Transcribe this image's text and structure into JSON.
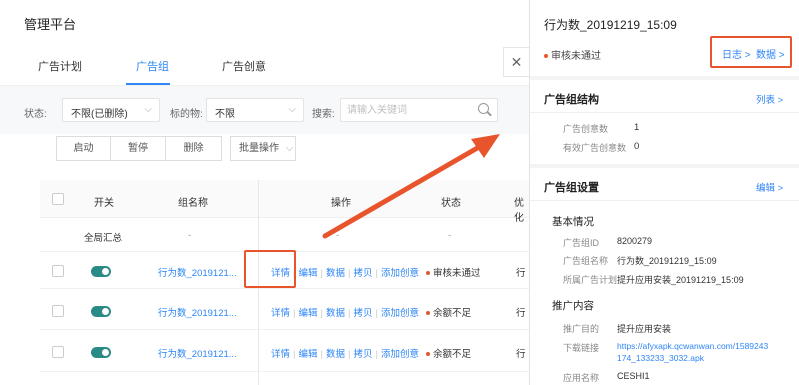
{
  "app": {
    "title": "管理平台"
  },
  "tabs": [
    {
      "label": "广告计划",
      "active": false
    },
    {
      "label": "广告组",
      "active": true
    },
    {
      "label": "广告创意",
      "active": false
    }
  ],
  "filters": {
    "status_label": "状态:",
    "status_value": "不限(已删除)",
    "target_label": "标的物:",
    "target_value": "不限",
    "search_label": "搜索:",
    "search_placeholder": "请输入关键词"
  },
  "actions": {
    "start": "启动",
    "pause": "暂停",
    "delete": "删除",
    "batch": "批量操作"
  },
  "table": {
    "headers": {
      "switch": "开关",
      "name": "组名称",
      "ops": "操作",
      "status": "状态",
      "budget": "优化"
    },
    "summary": {
      "label": "全局汇总",
      "name": "-",
      "ops": "-",
      "status": "-"
    },
    "rows": [
      {
        "name": "行为数_2019121...",
        "ops": [
          "详情",
          "编辑",
          "数据",
          "拷贝",
          "添加创意"
        ],
        "status": "审核未通过",
        "status_color": "#e8552c",
        "extra": "行"
      },
      {
        "name": "行为数_2019121...",
        "ops": [
          "详情",
          "编辑",
          "数据",
          "拷贝",
          "添加创意"
        ],
        "status": "余额不足",
        "status_color": "#e8552c",
        "extra": "行"
      },
      {
        "name": "行为数_2019121...",
        "ops": [
          "详情",
          "编辑",
          "数据",
          "拷贝",
          "添加创意"
        ],
        "status": "余额不足",
        "status_color": "#e8552c",
        "extra": "行"
      }
    ]
  },
  "panel": {
    "title": "行为数_20191219_15:09",
    "status": "审核未通过",
    "status_color": "#e8552c",
    "log_link": "日志 >",
    "data_link": "数据 >",
    "structure": {
      "title": "广告组结构",
      "link": "列表 >",
      "creative_count_label": "广告创意数",
      "creative_count": "1",
      "valid_count_label": "有效广告创意数",
      "valid_count": "0"
    },
    "settings": {
      "title": "广告组设置",
      "link": "编辑 >",
      "basic_title": "基本情况",
      "id_label": "广告组ID",
      "id_value": "8200279",
      "name_label": "广告组名称",
      "name_value": "行为数_20191219_15:09",
      "plan_label": "所属广告计划",
      "plan_value": "提升应用安装_20191219_15:09",
      "promo_title": "推广内容",
      "goal_label": "推广目的",
      "goal_value": "提升应用安装",
      "download_label": "下载链接",
      "download_value_1": "https://afyxapk.qcwanwan.com/1589243",
      "download_value_2": "174_133233_3032.apk",
      "app_label": "应用名称",
      "app_value": "CESHI1"
    }
  },
  "colors": {
    "accent": "#2f86f6",
    "highlight": "#e8552c",
    "toggle": "#2a8a86"
  }
}
